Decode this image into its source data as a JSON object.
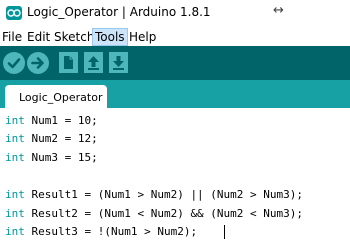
{
  "window": {
    "title": "Logic_Operator | Arduino 1.8.1",
    "resize_glyph": "↔"
  },
  "menu": {
    "items": [
      "File",
      "Edit",
      "Sketch",
      "Tools",
      "Help"
    ],
    "active": "Tools"
  },
  "toolbar": {
    "buttons": [
      "verify-icon",
      "upload-icon",
      "new-icon",
      "open-icon",
      "save-icon"
    ]
  },
  "tabs": [
    {
      "label": "Logic_Operator"
    }
  ],
  "editor": {
    "lines": [
      {
        "type": "int",
        "rest": " Num1 = 10;"
      },
      {
        "type": "int",
        "rest": " Num2 = 12;"
      },
      {
        "type": "int",
        "rest": " Num3 = 15;"
      },
      {
        "type": "",
        "rest": ""
      },
      {
        "type": "int",
        "rest": " Result1 = (Num1 > Num2) || (Num2 > Num3);"
      },
      {
        "type": "int",
        "rest": " Result2 = (Num1 < Num2) && (Num2 < Num3);"
      },
      {
        "type": "int",
        "rest": " Result3 = !(Num1 > Num2);"
      }
    ]
  },
  "colors": {
    "toolbar_bg": "#006468",
    "tabbar_bg": "#17a1a5",
    "button": "#4db7bb",
    "keyword": "#00979c"
  }
}
